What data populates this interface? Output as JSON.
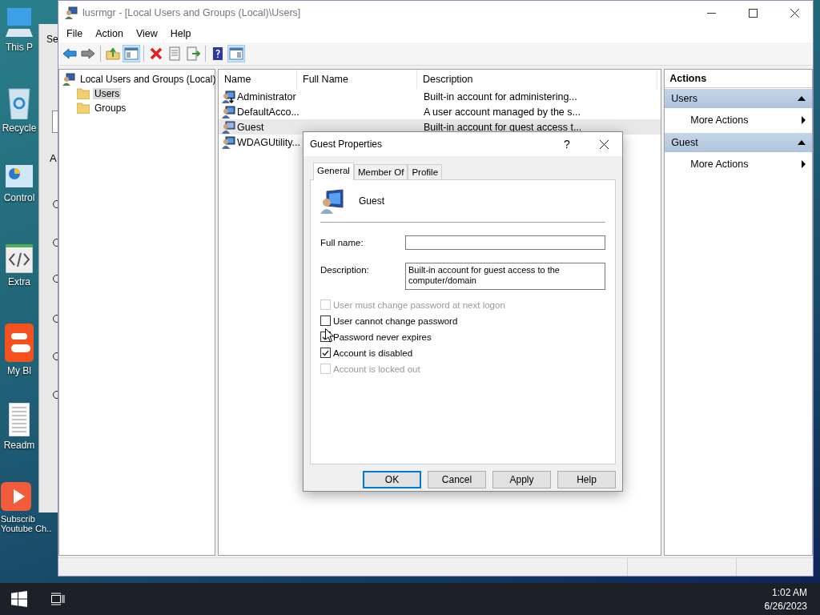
{
  "desktop": {
    "icons": [
      {
        "kind": "computer",
        "label": "This P"
      },
      {
        "kind": "recycle",
        "label": "Recycle"
      },
      {
        "kind": "control",
        "label": "Control"
      },
      {
        "kind": "code",
        "label": "Extra"
      },
      {
        "kind": "blog",
        "label": "My Bl"
      },
      {
        "kind": "document",
        "label": "Readm"
      },
      {
        "kind": "video",
        "label": "Subscrib",
        "label_2": "Youtube Ch.."
      }
    ]
  },
  "background_window": {
    "title": "Se",
    "heading": "A"
  },
  "window": {
    "title": "lusrmgr - [Local Users and Groups (Local)\\Users]",
    "menu": [
      "File",
      "Action",
      "View",
      "Help"
    ],
    "toolbar": [
      {
        "kind": "back",
        "pressed": false
      },
      {
        "kind": "forward",
        "pressed": false
      },
      {
        "kind": "separator"
      },
      {
        "kind": "up",
        "pressed": false
      },
      {
        "kind": "tree",
        "pressed": true
      },
      {
        "kind": "separator"
      },
      {
        "kind": "delete",
        "pressed": false
      },
      {
        "kind": "properties",
        "pressed": false
      },
      {
        "kind": "export",
        "pressed": false
      },
      {
        "kind": "separator"
      },
      {
        "kind": "help",
        "pressed": false
      },
      {
        "kind": "actionpane",
        "pressed": true
      }
    ]
  },
  "tree": {
    "label": "Local Users and Groups (Local)",
    "children": [
      {
        "label": "Users",
        "selected": true
      },
      {
        "label": "Groups",
        "selected": false
      }
    ]
  },
  "table": {
    "columns": [
      "Name",
      "Full Name",
      "Description"
    ],
    "rows": [
      {
        "name": "Administrator",
        "description": "Built-in account for administering...",
        "disabled": true,
        "selected": false
      },
      {
        "name": "DefaultAcco...",
        "description": "A user account managed by the s...",
        "disabled": false,
        "selected": false
      },
      {
        "name": "Guest",
        "description": "Built-in account for guest access t...",
        "disabled": false,
        "selected": true
      },
      {
        "name": "WDAGUtility...",
        "disabled": false,
        "selected": false
      }
    ]
  },
  "actions": {
    "title": "Actions",
    "sections": [
      {
        "title": "Users",
        "expanded": true,
        "items": [
          "More Actions"
        ]
      },
      {
        "title": "Guest",
        "expanded": true,
        "items": [
          "More Actions"
        ]
      }
    ]
  },
  "dialog": {
    "title": "Guest Properties",
    "help": "?",
    "tabs": [
      {
        "label": "General",
        "selected": true
      },
      {
        "label": "Member Of",
        "selected": false
      },
      {
        "label": "Profile",
        "selected": false
      }
    ],
    "user": "Guest",
    "fields": [
      {
        "label": "Full name:"
      },
      {
        "label": "Description:",
        "value": "Built-in account for guest access to the computer/domain"
      }
    ],
    "checkboxes": [
      {
        "label": "User must change password at next logon",
        "checked": false,
        "disabled": true
      },
      {
        "label": "User cannot change password",
        "checked": false,
        "disabled": false
      },
      {
        "label": "Password never expires",
        "checked": true,
        "disabled": false
      },
      {
        "label": "Account is disabled",
        "checked": true,
        "disabled": false
      },
      {
        "label": "Account is locked out",
        "checked": false,
        "disabled": true
      }
    ],
    "buttons": [
      {
        "label": "OK",
        "default": true
      },
      {
        "label": "Cancel",
        "default": false
      },
      {
        "label": "Apply",
        "default": false
      },
      {
        "label": "Help",
        "default": false
      }
    ]
  },
  "taskbar": {
    "time": "1:02 AM",
    "date": "6/26/2023"
  }
}
